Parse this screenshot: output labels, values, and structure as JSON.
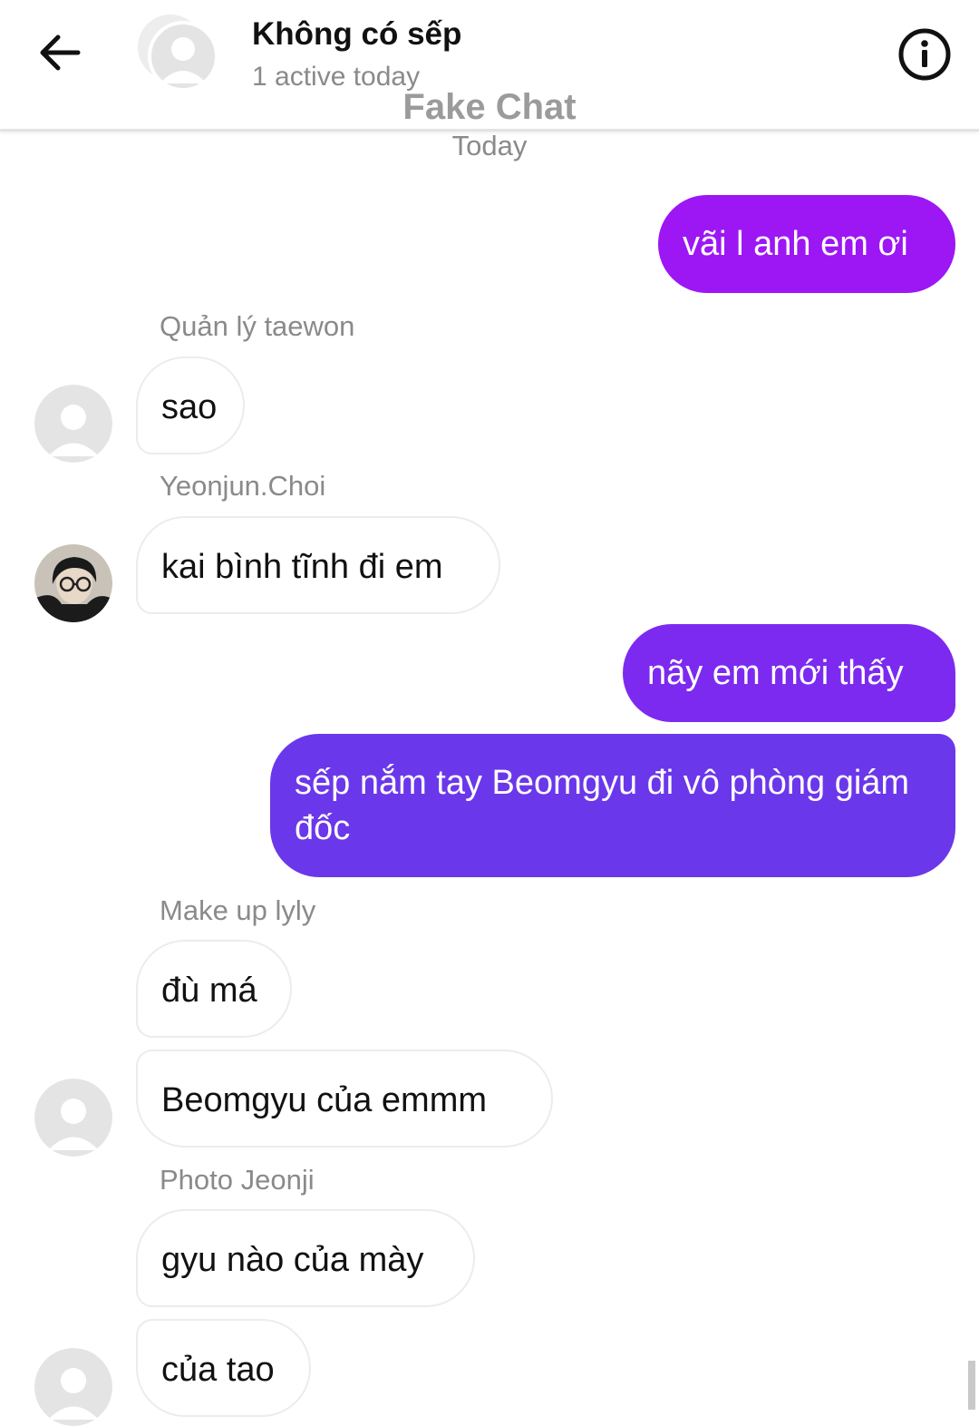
{
  "header": {
    "title": "Không có sếp",
    "subtitle": "1 active today",
    "back_icon": "arrow-left-icon",
    "info_icon": "info-circle-icon"
  },
  "watermark": "Fake Chat",
  "date_separator": "Today",
  "colors": {
    "outgoing_purple": "#9d16f4",
    "outgoing_indigo": "#6b37ea",
    "incoming_bg": "#ffffff",
    "secondary_text": "#8a8a8a"
  },
  "messages": [
    {
      "direction": "out",
      "text": "vãi l anh em ơi"
    },
    {
      "direction": "in",
      "sender": "Quản lý taewon",
      "text": "sao"
    },
    {
      "direction": "in",
      "sender": "Yeonjun.Choi",
      "text": "kai bình tĩnh đi em"
    },
    {
      "direction": "out",
      "text": "nãy em mới thấy"
    },
    {
      "direction": "out",
      "text": "sếp nắm tay Beomgyu đi vô phòng giám đốc"
    },
    {
      "direction": "in",
      "sender": "Make up lyly",
      "text": "đù má"
    },
    {
      "direction": "in",
      "text": "Beomgyu của emmm"
    },
    {
      "direction": "in",
      "sender": "Photo Jeonji",
      "text": "gyu nào của mày"
    },
    {
      "direction": "in",
      "text": "của tao"
    }
  ]
}
